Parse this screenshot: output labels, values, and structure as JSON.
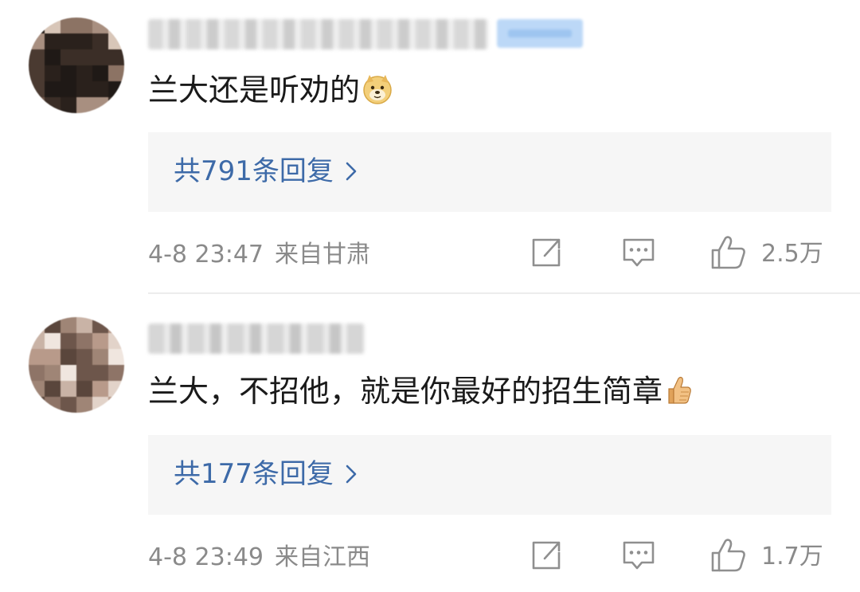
{
  "comments": [
    {
      "text": "兰大还是听劝的",
      "emoji": "doge-emoji",
      "replies_label": "共791条回复",
      "time": "4-8 23:47",
      "location": "来自甘肃",
      "likes": "2.5万"
    },
    {
      "text": "兰大，不招他，就是你最好的招生简章",
      "emoji": "thumbs-up-emoji",
      "replies_label": "共177条回复",
      "time": "4-8 23:49",
      "location": "来自江西",
      "likes": "1.7万"
    }
  ],
  "icons": {
    "share": "share-icon",
    "comment": "comment-icon",
    "like": "thumbs-up-icon",
    "chevron": "chevron-right-icon"
  },
  "colors": {
    "link": "#3d6aa8",
    "meta": "#8a8a8a",
    "reply_box_bg": "#f6f6f6"
  }
}
